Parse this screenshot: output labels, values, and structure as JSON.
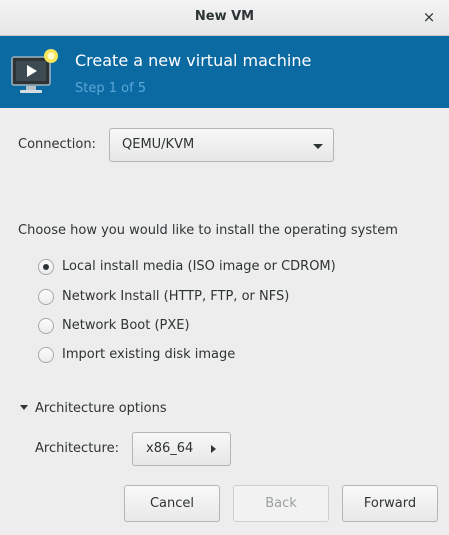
{
  "window": {
    "title": "New VM",
    "close_glyph": "×"
  },
  "banner": {
    "heading": "Create a new virtual machine",
    "step": "Step 1 of 5",
    "icon": "virtual-machine-icon",
    "background": "#0c6aa3"
  },
  "connection": {
    "label": "Connection:",
    "value": "QEMU/KVM"
  },
  "install": {
    "prompt": "Choose how you would like to install the operating system",
    "options": [
      {
        "label": "Local install media (ISO image or CDROM)",
        "checked": true
      },
      {
        "label": "Network Install (HTTP, FTP, or NFS)",
        "checked": false
      },
      {
        "label": "Network Boot (PXE)",
        "checked": false
      },
      {
        "label": "Import existing disk image",
        "checked": false
      }
    ]
  },
  "architecture": {
    "expander_label": "Architecture options",
    "label": "Architecture:",
    "value": "x86_64"
  },
  "buttons": {
    "cancel": "Cancel",
    "back": "Back",
    "forward": "Forward"
  }
}
